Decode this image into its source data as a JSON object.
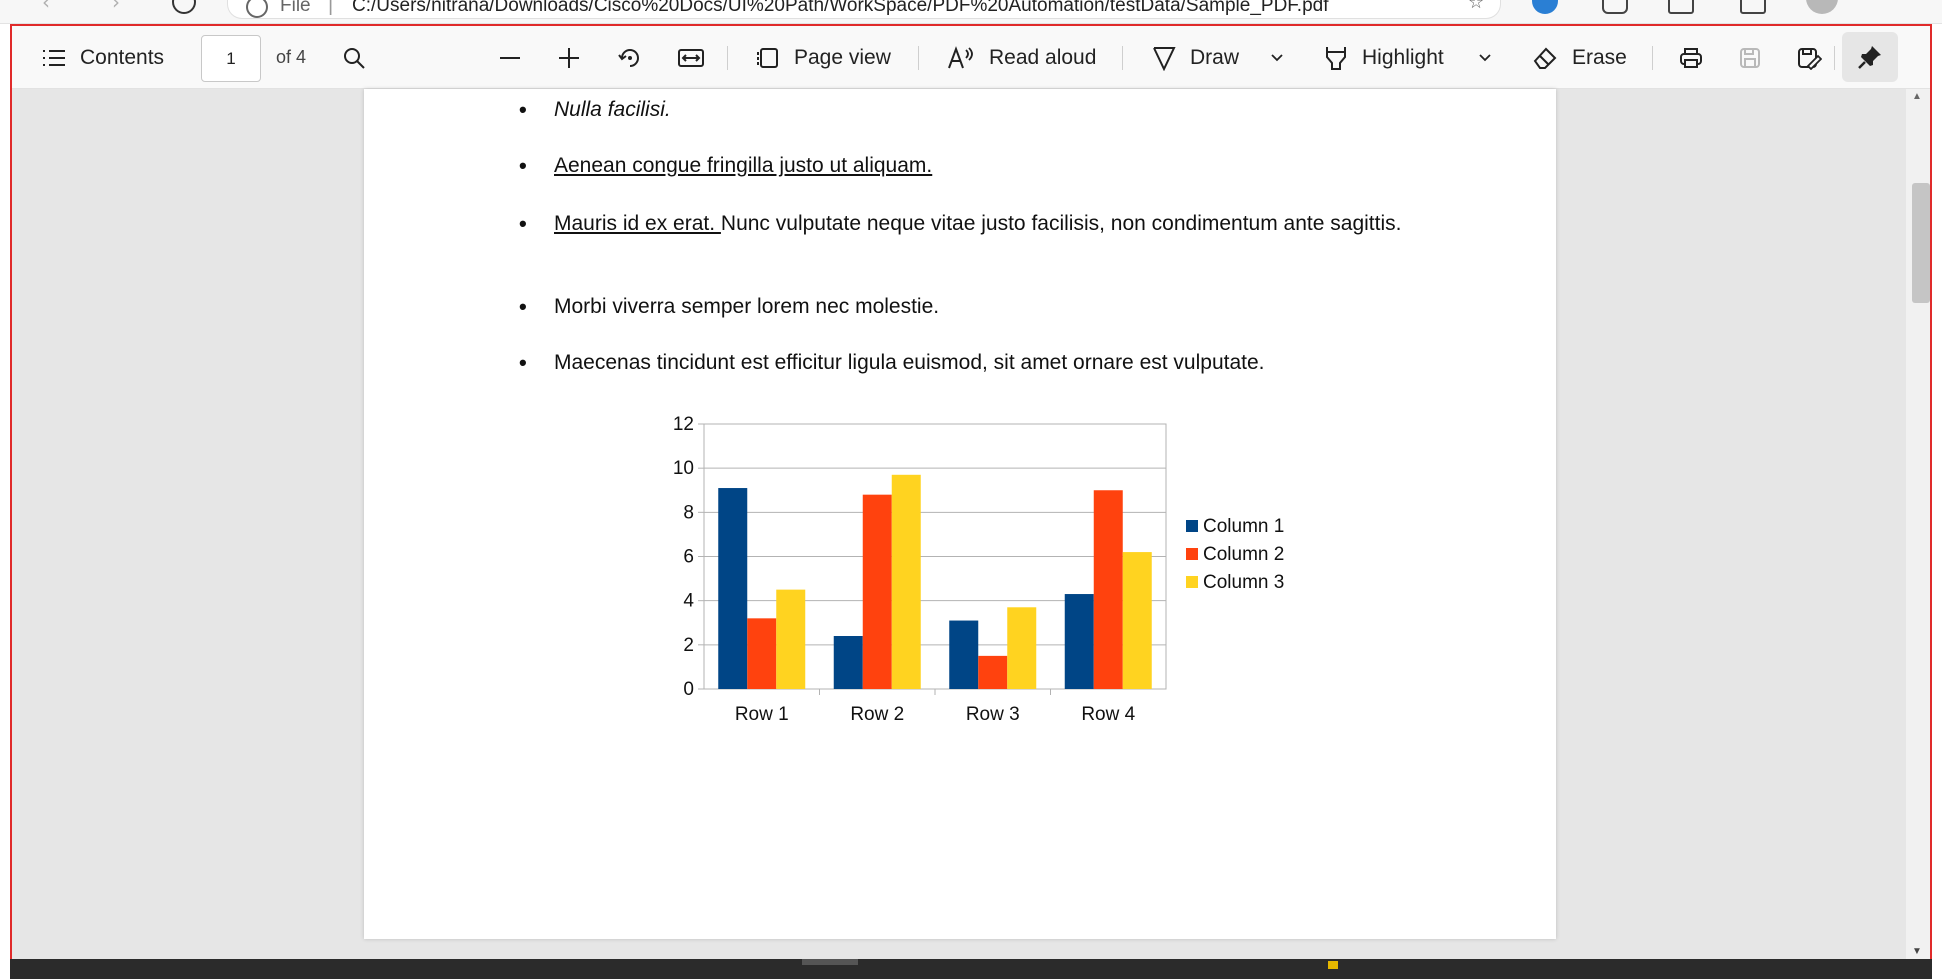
{
  "browser": {
    "address": {
      "scheme_label": "File",
      "url": "C:/Users/nitrana/Downloads/Cisco%20Docs/UI%20Path/WorkSpace/PDF%20Automation/testData/Sample_PDF.pdf"
    }
  },
  "toolbar": {
    "contents_label": "Contents",
    "page_current": "1",
    "page_total_label": "of 4",
    "page_view_label": "Page view",
    "read_aloud_label": "Read aloud",
    "draw_label": "Draw",
    "highlight_label": "Highlight",
    "erase_label": "Erase"
  },
  "document": {
    "bullets": [
      {
        "text": "Nulla facilisi.",
        "style": "italic"
      },
      {
        "text": "Aenean congue fringilla justo ut aliquam. ",
        "style": "underline"
      },
      {
        "underlined_part": "Mauris id ex erat. ",
        "text": "Nunc vulputate neque vitae justo facilisis, non condimentum ante sagittis.",
        "style": "mixed"
      },
      {
        "text": "Morbi viverra semper lorem nec molestie.",
        "style": "plain"
      },
      {
        "text": "Maecenas tincidunt est efficitur ligula euismod, sit amet ornare est vulputate.",
        "style": "plain"
      }
    ]
  },
  "chart_data": {
    "type": "bar",
    "categories": [
      "Row 1",
      "Row 2",
      "Row 3",
      "Row 4"
    ],
    "series": [
      {
        "name": "Column 1",
        "values": [
          9.1,
          2.4,
          3.1,
          4.3
        ],
        "color": "#004586"
      },
      {
        "name": "Column 2",
        "values": [
          3.2,
          8.8,
          1.5,
          9.0
        ],
        "color": "#ff420e"
      },
      {
        "name": "Column 3",
        "values": [
          4.5,
          9.7,
          3.7,
          6.2
        ],
        "color": "#ffd320"
      }
    ],
    "yticks": [
      0,
      2,
      4,
      6,
      8,
      10,
      12
    ],
    "ylim": [
      0,
      12
    ],
    "grid": true,
    "legend": "right",
    "title": "",
    "xlabel": "",
    "ylabel": ""
  }
}
